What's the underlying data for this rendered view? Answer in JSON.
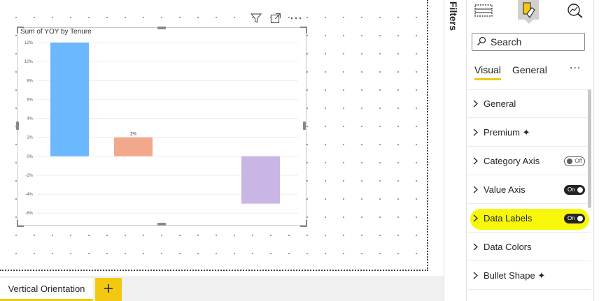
{
  "page_tabs": [
    {
      "label": "Vertical Orientation",
      "active": true
    }
  ],
  "add_page_icon": "plus-icon",
  "visual": {
    "title": "Sum of YOY by Tenure",
    "header_icons": [
      "filter-icon",
      "focus-mode-icon",
      "more-options-icon"
    ]
  },
  "chart_data": {
    "type": "bar",
    "title": "Sum of YOY by Tenure",
    "xlabel": "",
    "ylabel": "",
    "categories": [
      "",
      "",
      "",
      ""
    ],
    "series": [
      {
        "values": [
          12,
          2,
          0,
          -5
        ],
        "colors": [
          "#6cb8ff",
          "#f2a98b",
          "#ffffff",
          "#c9b6e4"
        ]
      }
    ],
    "data_labels": [
      "",
      "2%",
      "",
      ""
    ],
    "ylim": [
      -6.5,
      12
    ],
    "yticks": [
      "12%",
      "10%",
      "8%",
      "6%",
      "4%",
      "2%",
      "0%",
      "-2%",
      "-4%",
      "-6%"
    ],
    "ytick_values": [
      12,
      10,
      8,
      6,
      4,
      2,
      0,
      -2,
      -4,
      -6
    ],
    "grid": true
  },
  "filters_pane": {
    "label": "Filters"
  },
  "visualizations_pane": {
    "icons": [
      "build-visual-icon",
      "format-visual-icon",
      "analytics-icon"
    ],
    "search": {
      "placeholder": "Search"
    },
    "tabs": [
      {
        "label": "Visual",
        "active": true
      },
      {
        "label": "General",
        "active": false
      }
    ],
    "more_label": "···",
    "sections": [
      {
        "label": "General"
      },
      {
        "label": "Premium ✦"
      },
      {
        "label": "Category Axis",
        "toggle": "Off"
      },
      {
        "label": "Value Axis",
        "toggle": "On"
      },
      {
        "label": "Data Labels",
        "toggle": "On",
        "highlighted": true
      },
      {
        "label": "Data Colors"
      },
      {
        "label": "Bullet Shape ✦"
      }
    ]
  },
  "colors": {
    "accent": "#f2c811",
    "highlight": "#f7f70a"
  }
}
